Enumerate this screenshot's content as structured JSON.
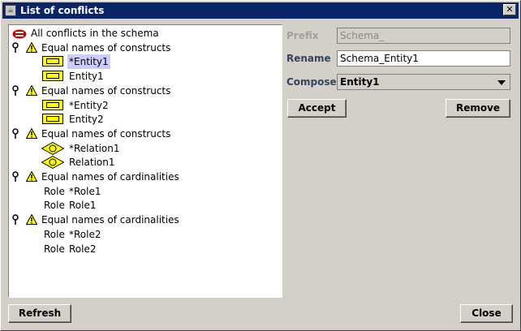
{
  "window": {
    "title": "List of conflicts"
  },
  "tree": {
    "root": "All conflicts in the schema",
    "groups": [
      {
        "title": "Equal names of constructs",
        "items": [
          {
            "kind": "entity",
            "label": "*Entity1",
            "selected": true
          },
          {
            "kind": "entity",
            "label": "Entity1"
          }
        ]
      },
      {
        "title": "Equal names of constructs",
        "items": [
          {
            "kind": "entity",
            "label": "*Entity2"
          },
          {
            "kind": "entity",
            "label": "Entity2"
          }
        ]
      },
      {
        "title": "Equal names of constructs",
        "items": [
          {
            "kind": "relation",
            "label": "*Relation1"
          },
          {
            "kind": "relation",
            "label": "Relation1"
          }
        ]
      },
      {
        "title": "Equal names of cardinalities",
        "items": [
          {
            "kind": "role",
            "prefix": "Role",
            "label": "*Role1"
          },
          {
            "kind": "role",
            "prefix": "Role",
            "label": "Role1"
          }
        ]
      },
      {
        "title": "Equal names of cardinalities",
        "items": [
          {
            "kind": "role",
            "prefix": "Role",
            "label": "*Role2"
          },
          {
            "kind": "role",
            "prefix": "Role",
            "label": "Role2"
          }
        ]
      }
    ]
  },
  "form": {
    "prefix_label": "Prefix",
    "prefix_value": "Schema_",
    "rename_label": "Rename",
    "rename_value": "Schema_Entity1",
    "compose_label": "Compose",
    "compose_value": "Entity1",
    "accept_label": "Accept",
    "remove_label": "Remove"
  },
  "footer": {
    "refresh_label": "Refresh",
    "close_label": "Close"
  },
  "icons": {
    "root": "schema-icon",
    "group": "key-icon",
    "warning": "warning-icon",
    "entity": "entity-icon",
    "relation": "relation-icon"
  },
  "colors": {
    "titlebar": "#0a246a",
    "selection": "#ccccff",
    "entity_fill": "#ffff00",
    "label": "#334466",
    "schema_icon": "#cc0000"
  }
}
